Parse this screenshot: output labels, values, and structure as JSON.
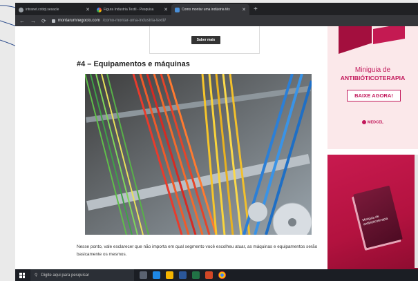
{
  "tabs": [
    {
      "title": "intranet.cotiqt.sesacle"
    },
    {
      "title": "Figura Industria Textil - Pesquisa"
    },
    {
      "title": "Como montar uma indústria têx"
    }
  ],
  "address": {
    "host": "montarumnegocio.com",
    "path": "/como-montar-uma-industria-textil/"
  },
  "banner": {
    "button": "Saber mais"
  },
  "article": {
    "heading": "#4 – Equipamentos e máquinas",
    "paragraph": "Nesse ponto, vale esclarecer que não importa em qual segmento você escolheu atuar, as máquinas e equipamentos serão basicamente os mesmos."
  },
  "ad_top": {
    "line1": "Miniguia de",
    "line2": "ANTIBIÓTICOTERAPIA",
    "cta": "BAIXE AGORA!",
    "brand": "MEDCEL"
  },
  "ad_bottom": {
    "book_title": "Miniguia de antibióticoterapia"
  },
  "taskbar": {
    "search_placeholder": "Digite aqui para pesquisar"
  },
  "colors": {
    "accent": "#c2185b",
    "taskbar": "#1b1e24",
    "tabbar": "#202124"
  }
}
